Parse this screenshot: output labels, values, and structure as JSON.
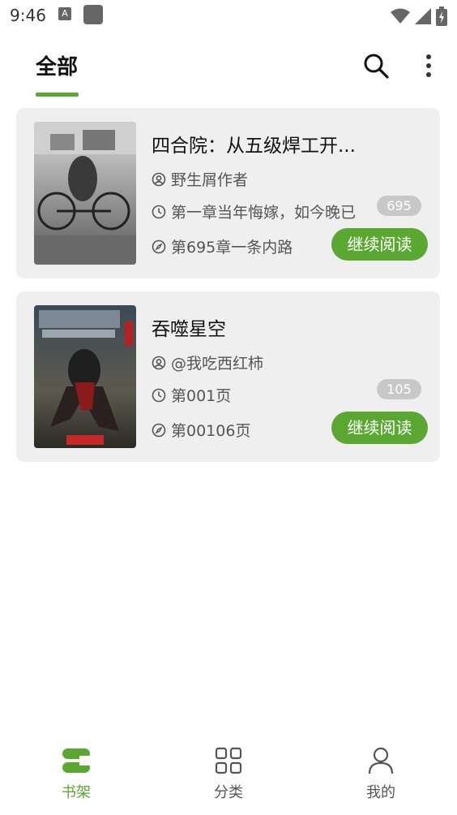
{
  "status_bar": {
    "time": "9:46",
    "notif_letter": "A"
  },
  "header": {
    "tab_label": "全部"
  },
  "books": [
    {
      "title": "四合院：从五级焊工开...",
      "author": "野生屑作者",
      "latest_chapter": "第一章当年悔嫁，如今晚已",
      "progress": "第695章一条内路",
      "badge_count": "695",
      "continue_label": "继续阅读"
    },
    {
      "title": "吞噬星空",
      "author": "@我吃西红柿",
      "latest_chapter": "第001页",
      "progress": "第00106页",
      "badge_count": "105",
      "continue_label": "继续阅读"
    }
  ],
  "bottom_nav": {
    "items": [
      {
        "label": "书架",
        "icon": "bookshelf-icon",
        "active": true
      },
      {
        "label": "分类",
        "icon": "grid-icon",
        "active": false
      },
      {
        "label": "我的",
        "icon": "person-icon",
        "active": false
      }
    ]
  },
  "colors": {
    "accent": "#5aa832",
    "card_bg": "#efefef",
    "badge_bg": "#c8c8c8"
  }
}
